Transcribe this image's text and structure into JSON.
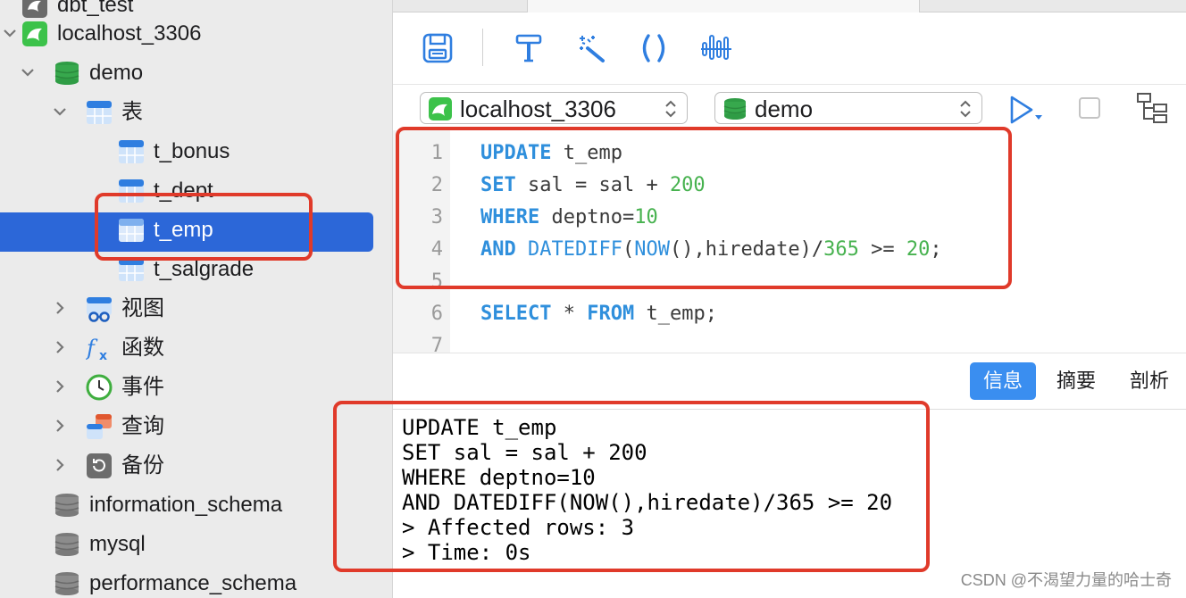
{
  "sidebar": {
    "items": [
      {
        "label": "dbt_test",
        "kind": "mysql"
      },
      {
        "label": "localhost_3306",
        "kind": "mysql"
      },
      {
        "label": "demo",
        "kind": "database"
      },
      {
        "label": "表",
        "kind": "tables"
      },
      {
        "label": "t_bonus",
        "kind": "table"
      },
      {
        "label": "t_dept",
        "kind": "table"
      },
      {
        "label": "t_emp",
        "kind": "table",
        "selected": true
      },
      {
        "label": "t_salgrade",
        "kind": "table"
      },
      {
        "label": "视图",
        "kind": "views"
      },
      {
        "label": "函数",
        "kind": "functions"
      },
      {
        "label": "事件",
        "kind": "events"
      },
      {
        "label": "查询",
        "kind": "queries"
      },
      {
        "label": "备份",
        "kind": "backups"
      },
      {
        "label": "information_schema",
        "kind": "database-gray"
      },
      {
        "label": "mysql",
        "kind": "database-gray"
      },
      {
        "label": "performance_schema",
        "kind": "database-gray"
      }
    ]
  },
  "toolbar": {
    "icons": [
      "save-icon",
      "format-icon",
      "beautify-wand-icon",
      "brackets-icon",
      "explain-icon"
    ]
  },
  "connection": {
    "server": "localhost_3306",
    "database": "demo"
  },
  "editor": {
    "line_numbers": [
      "1",
      "2",
      "3",
      "4",
      "5",
      "6",
      "7"
    ],
    "lines": [
      [
        {
          "t": "kw",
          "v": "UPDATE"
        },
        {
          "t": "txt",
          "v": " t_emp"
        }
      ],
      [
        {
          "t": "kw",
          "v": "SET"
        },
        {
          "t": "txt",
          "v": " sal = sal + "
        },
        {
          "t": "num",
          "v": "200"
        }
      ],
      [
        {
          "t": "kw",
          "v": "WHERE"
        },
        {
          "t": "txt",
          "v": " deptno="
        },
        {
          "t": "num",
          "v": "10"
        }
      ],
      [
        {
          "t": "kw",
          "v": "AND"
        },
        {
          "t": "txt",
          "v": " "
        },
        {
          "t": "fn",
          "v": "DATEDIFF"
        },
        {
          "t": "txt",
          "v": "("
        },
        {
          "t": "fn",
          "v": "NOW"
        },
        {
          "t": "txt",
          "v": "(),hiredate)/"
        },
        {
          "t": "num",
          "v": "365"
        },
        {
          "t": "txt",
          "v": " >= "
        },
        {
          "t": "num",
          "v": "20"
        },
        {
          "t": "txt",
          "v": ";"
        }
      ],
      [],
      [
        {
          "t": "kw",
          "v": "SELECT"
        },
        {
          "t": "txt",
          "v": " * "
        },
        {
          "t": "kw",
          "v": "FROM"
        },
        {
          "t": "txt",
          "v": " t_emp;"
        }
      ],
      []
    ]
  },
  "results": {
    "tabs": [
      "信息",
      "摘要",
      "剖析"
    ],
    "active_tab": 0,
    "output": [
      "UPDATE t_emp",
      "SET sal = sal + 200",
      "WHERE deptno=10",
      "AND DATEDIFF(NOW(),hiredate)/365 >= 20",
      "> Affected rows: 3",
      "> Time: 0s"
    ]
  },
  "watermark": "CSDN @不渴望力量的哈士奇",
  "colors": {
    "keyword": "#2f8fdc",
    "number": "#47b24f",
    "selection": "#2c67d8",
    "annotation": "#e03a2a"
  }
}
